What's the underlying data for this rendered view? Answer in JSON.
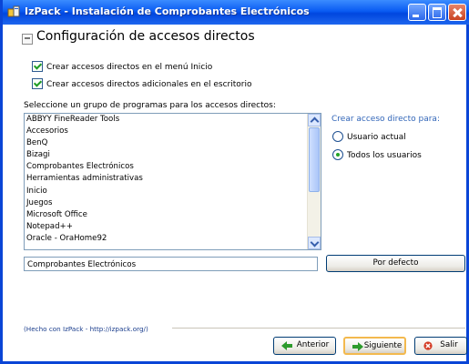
{
  "window": {
    "title": "IzPack - Instalación de Comprobantes Electrónicos",
    "icons": [
      "application-icon",
      "minimize-icon",
      "maximize-icon",
      "close-icon"
    ],
    "colors": {
      "titlebar": "#0046df",
      "accent": "#3165b8",
      "selected_radio": "#25a527"
    }
  },
  "panel": {
    "heading": "Configuración de accesos directos",
    "options": [
      {
        "label": "Crear accesos directos en el menú Inicio",
        "checked": true
      },
      {
        "label": "Crear accesos directos adicionales en el escritorio",
        "checked": true
      }
    ],
    "group_label": "Seleccione un grupo de programas para los accesos directos:",
    "groups": [
      "ABBYY FineReader Tools",
      "Accesorios",
      "BenQ",
      "Bizagi",
      "Comprobantes Electrónicos",
      "Herramientas administrativas",
      "Inicio",
      "Juegos",
      "Microsoft Office",
      "Notepad++",
      "Oracle - OraHome92"
    ],
    "shortcut_for": "Crear acceso directo para:",
    "users": [
      {
        "label": "Usuario actual",
        "selected": false
      },
      {
        "label": "Todos los usuarios",
        "selected": true
      }
    ],
    "program_group_value": "Comprobantes Electrónicos",
    "default_button": "Por defecto"
  },
  "footer": {
    "credit": "(Hecho con IzPack - http://izpack.org/)",
    "previous": "Anterior",
    "next": "Siguiente",
    "exit": "Salir"
  }
}
